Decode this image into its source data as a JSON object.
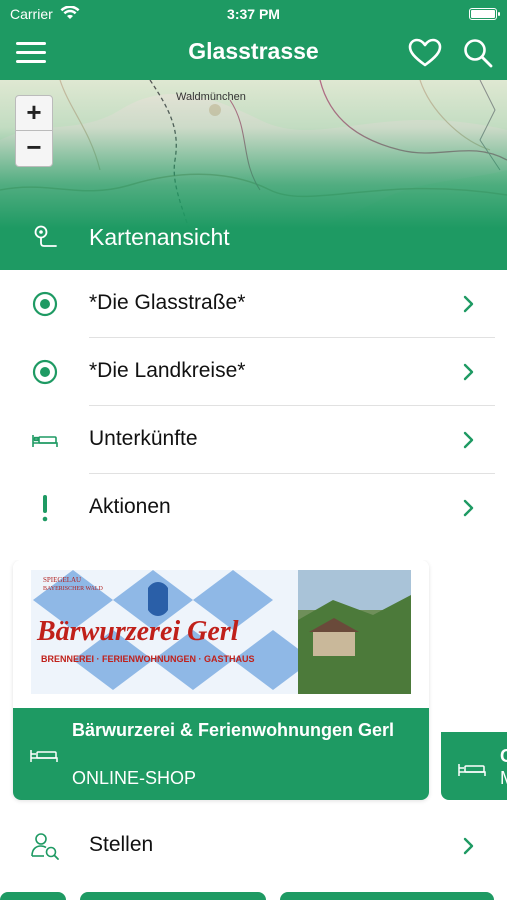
{
  "status": {
    "carrier": "Carrier",
    "time": "3:37 PM"
  },
  "nav": {
    "title": "Glasstrasse",
    "menu_icon": "hamburger-menu-icon",
    "favorites_icon": "heart-icon",
    "search_icon": "search-icon"
  },
  "map": {
    "zoom_in": "+",
    "zoom_out": "−",
    "town_label": "Waldmünchen",
    "label": "Kartenansicht",
    "icon": "map-pin-icon"
  },
  "menu": [
    {
      "label": "*Die Glasstraße*",
      "icon": "radio-dot-icon"
    },
    {
      "label": "*Die Landkreise*",
      "icon": "radio-dot-icon"
    },
    {
      "label": "Unterkünfte",
      "icon": "bed-icon"
    },
    {
      "label": "Aktionen",
      "icon": "exclamation-icon"
    }
  ],
  "cards": [
    {
      "image_alt": "Bärwurzerei Gerl",
      "logo_line1": "SPIEGELAU",
      "logo_line2": "BAYERISCHER WALD",
      "logo_main": "Bärwurzerei Gerl",
      "logo_sub": "BRENNEREI · FERIENWOHNUNGEN · GASTHAUS",
      "title": "Bärwurzerei & Ferienwohnungen Gerl",
      "subtitle": "ONLINE-SHOP",
      "icon": "bed-icon"
    },
    {
      "title": "C",
      "subtitle": "M",
      "icon": "bed-icon"
    }
  ],
  "stellen": {
    "label": "Stellen",
    "icon": "person-search-icon"
  },
  "colors": {
    "primary": "#1e9a63",
    "text": "#111111",
    "separator": "#e1e1e1"
  }
}
